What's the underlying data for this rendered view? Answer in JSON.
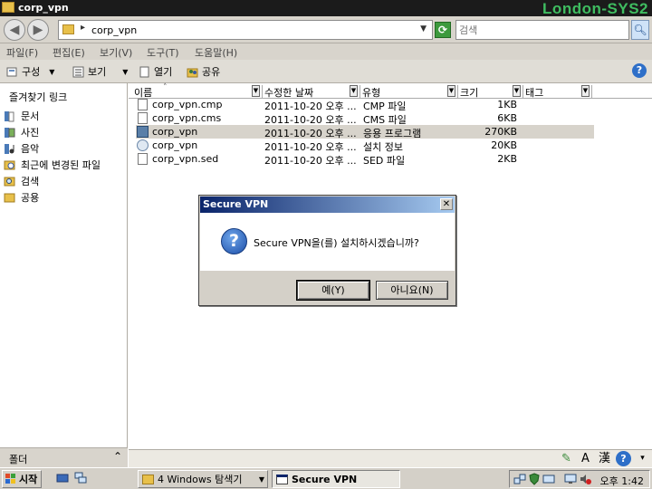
{
  "window": {
    "title": "corp_vpn",
    "watermark": "London-SYS2"
  },
  "address": {
    "path": "corp_vpn",
    "search_placeholder": "검색"
  },
  "menu": [
    "파일(F)",
    "편집(E)",
    "보기(V)",
    "도구(T)",
    "도움말(H)"
  ],
  "toolbar": {
    "organize": "구성",
    "views": "보기",
    "open": "열기",
    "share": "공유"
  },
  "nav": {
    "header": "즐겨찾기 링크",
    "items": [
      "문서",
      "사진",
      "음악",
      "최근에 변경된 파일",
      "검색",
      "공용"
    ],
    "folders_label": "폴더"
  },
  "columns": {
    "name": "이름",
    "modified": "수정한 날짜",
    "type": "유형",
    "size": "크기",
    "tags": "태그"
  },
  "files": [
    {
      "name": "corp_vpn.cmp",
      "modified": "2011-10-20 오후 ...",
      "type": "CMP 파일",
      "size": "1KB",
      "icon": "file-icon"
    },
    {
      "name": "corp_vpn.cms",
      "modified": "2011-10-20 오후 ...",
      "type": "CMS 파일",
      "size": "6KB",
      "icon": "file-icon"
    },
    {
      "name": "corp_vpn",
      "modified": "2011-10-20 오후 ...",
      "type": "응용 프로그램",
      "size": "270KB",
      "icon": "app-icon"
    },
    {
      "name": "corp_vpn",
      "modified": "2011-10-20 오후 ...",
      "type": "설치 정보",
      "size": "20KB",
      "icon": "setup-icon"
    },
    {
      "name": "corp_vpn.sed",
      "modified": "2011-10-20 오후 ...",
      "type": "SED 파일",
      "size": "2KB",
      "icon": "file-icon"
    }
  ],
  "dialog": {
    "title": "Secure VPN",
    "message": "Secure VPN을(를) 설치하시겠습니까?",
    "yes": "예(Y)",
    "no": "아니요(N)"
  },
  "langbar": {
    "ime_a": "A",
    "ime_hanja": "漢"
  },
  "taskbar": {
    "start": "시작",
    "explorer_group": "4 Windows 탐색기",
    "active_window": "Secure VPN",
    "clock": "오후 1:42"
  }
}
